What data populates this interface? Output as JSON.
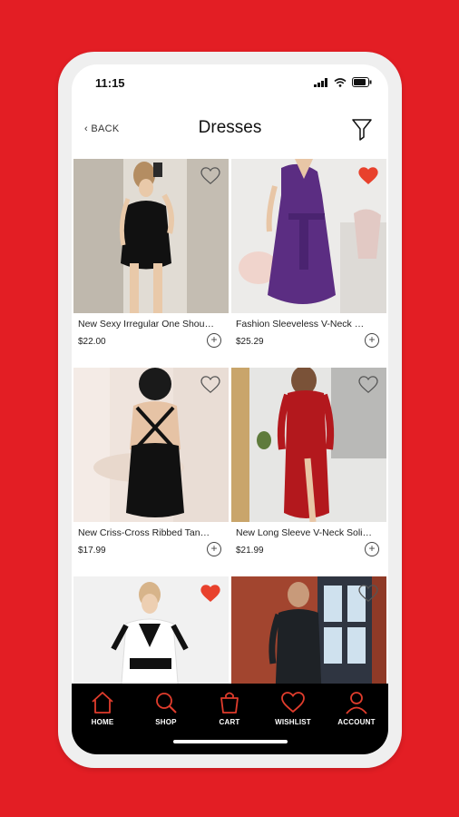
{
  "status": {
    "time": "11:15"
  },
  "header": {
    "back_label": "BACK",
    "title": "Dresses"
  },
  "products": [
    {
      "name": "New Sexy Irregular One Shoulder Dress",
      "price": "$22.00",
      "favorite": false
    },
    {
      "name": "Fashion Sleeveless V-Neck Wrap Dress",
      "price": "$25.29",
      "favorite": true
    },
    {
      "name": "New Criss-Cross Ribbed Tank Dress",
      "price": "$17.99",
      "favorite": false
    },
    {
      "name": "New Long Sleeve V-Neck Solid Dress",
      "price": "$21.99",
      "favorite": false
    },
    {
      "name": "",
      "price": "",
      "favorite": true
    },
    {
      "name": "",
      "price": "",
      "favorite": false
    }
  ],
  "nav": {
    "home": "HOME",
    "shop": "SHOP",
    "cart": "CART",
    "wishlist": "WISHLIST",
    "account": "ACCOUNT"
  },
  "colors": {
    "accent": "#e31e24",
    "nav_icon": "#e03c2c",
    "heart_fill": "#e8412c"
  }
}
